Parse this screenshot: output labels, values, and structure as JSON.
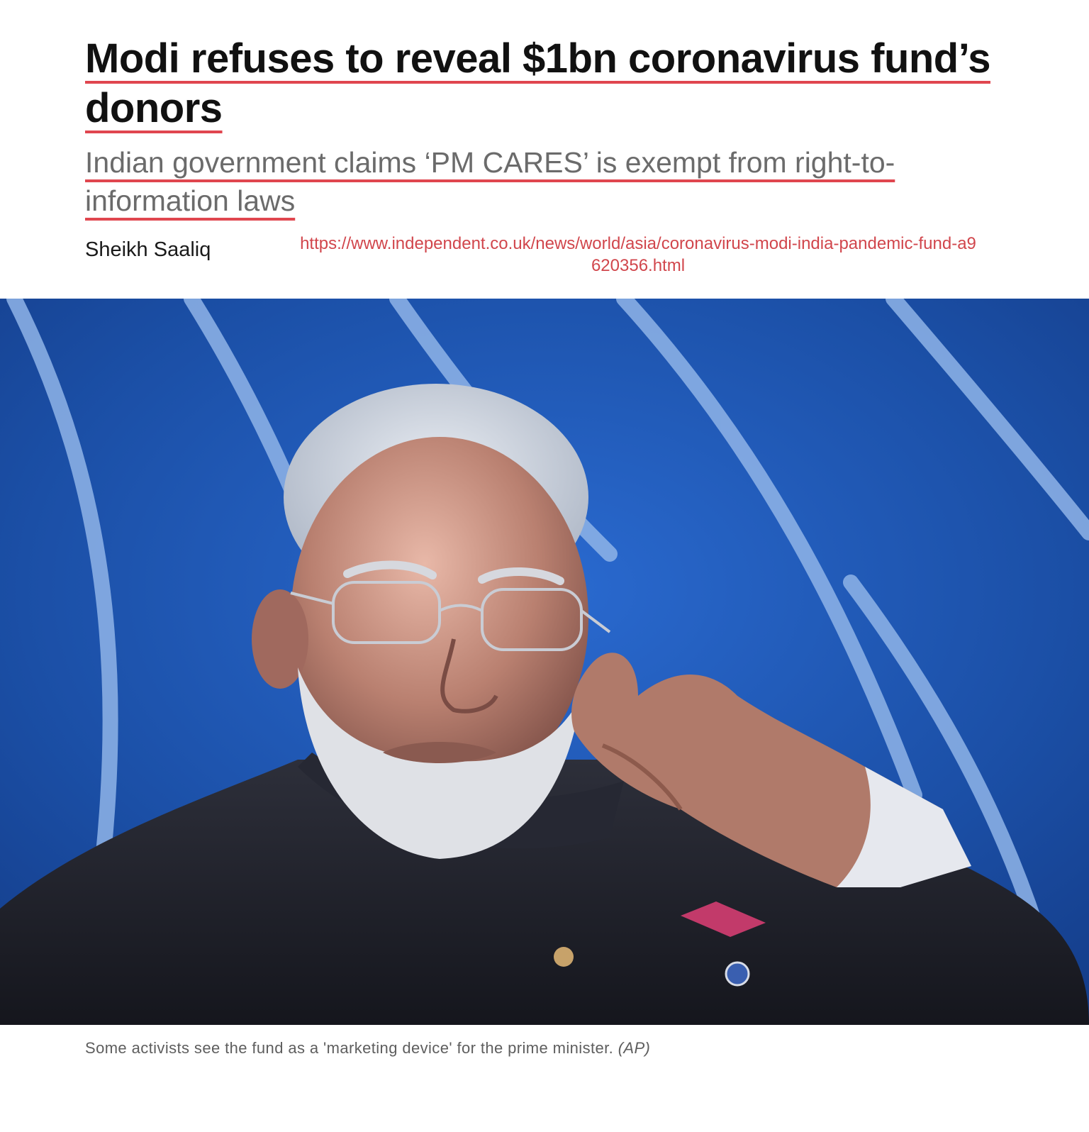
{
  "article": {
    "headline": "Modi refuses to reveal $1bn coronavirus fund’s donors",
    "standfirst": "Indian government claims ‘PM CARES’ is exempt from right-to-information laws",
    "author": "Sheikh Saaliq",
    "source_url": "https://www.independent.co.uk/news/world/asia/coronavirus-modi-india-pandemic-fund-a9620356.html"
  },
  "photo": {
    "caption": "Some activists see the fund as a 'marketing device' for the prime minister.",
    "credit": "(AP)"
  },
  "colors": {
    "underline_accent": "#e0464f",
    "url_text": "#d1464c",
    "standfirst_text": "#6b6b6b",
    "photo_background": "#1a4ea8"
  }
}
